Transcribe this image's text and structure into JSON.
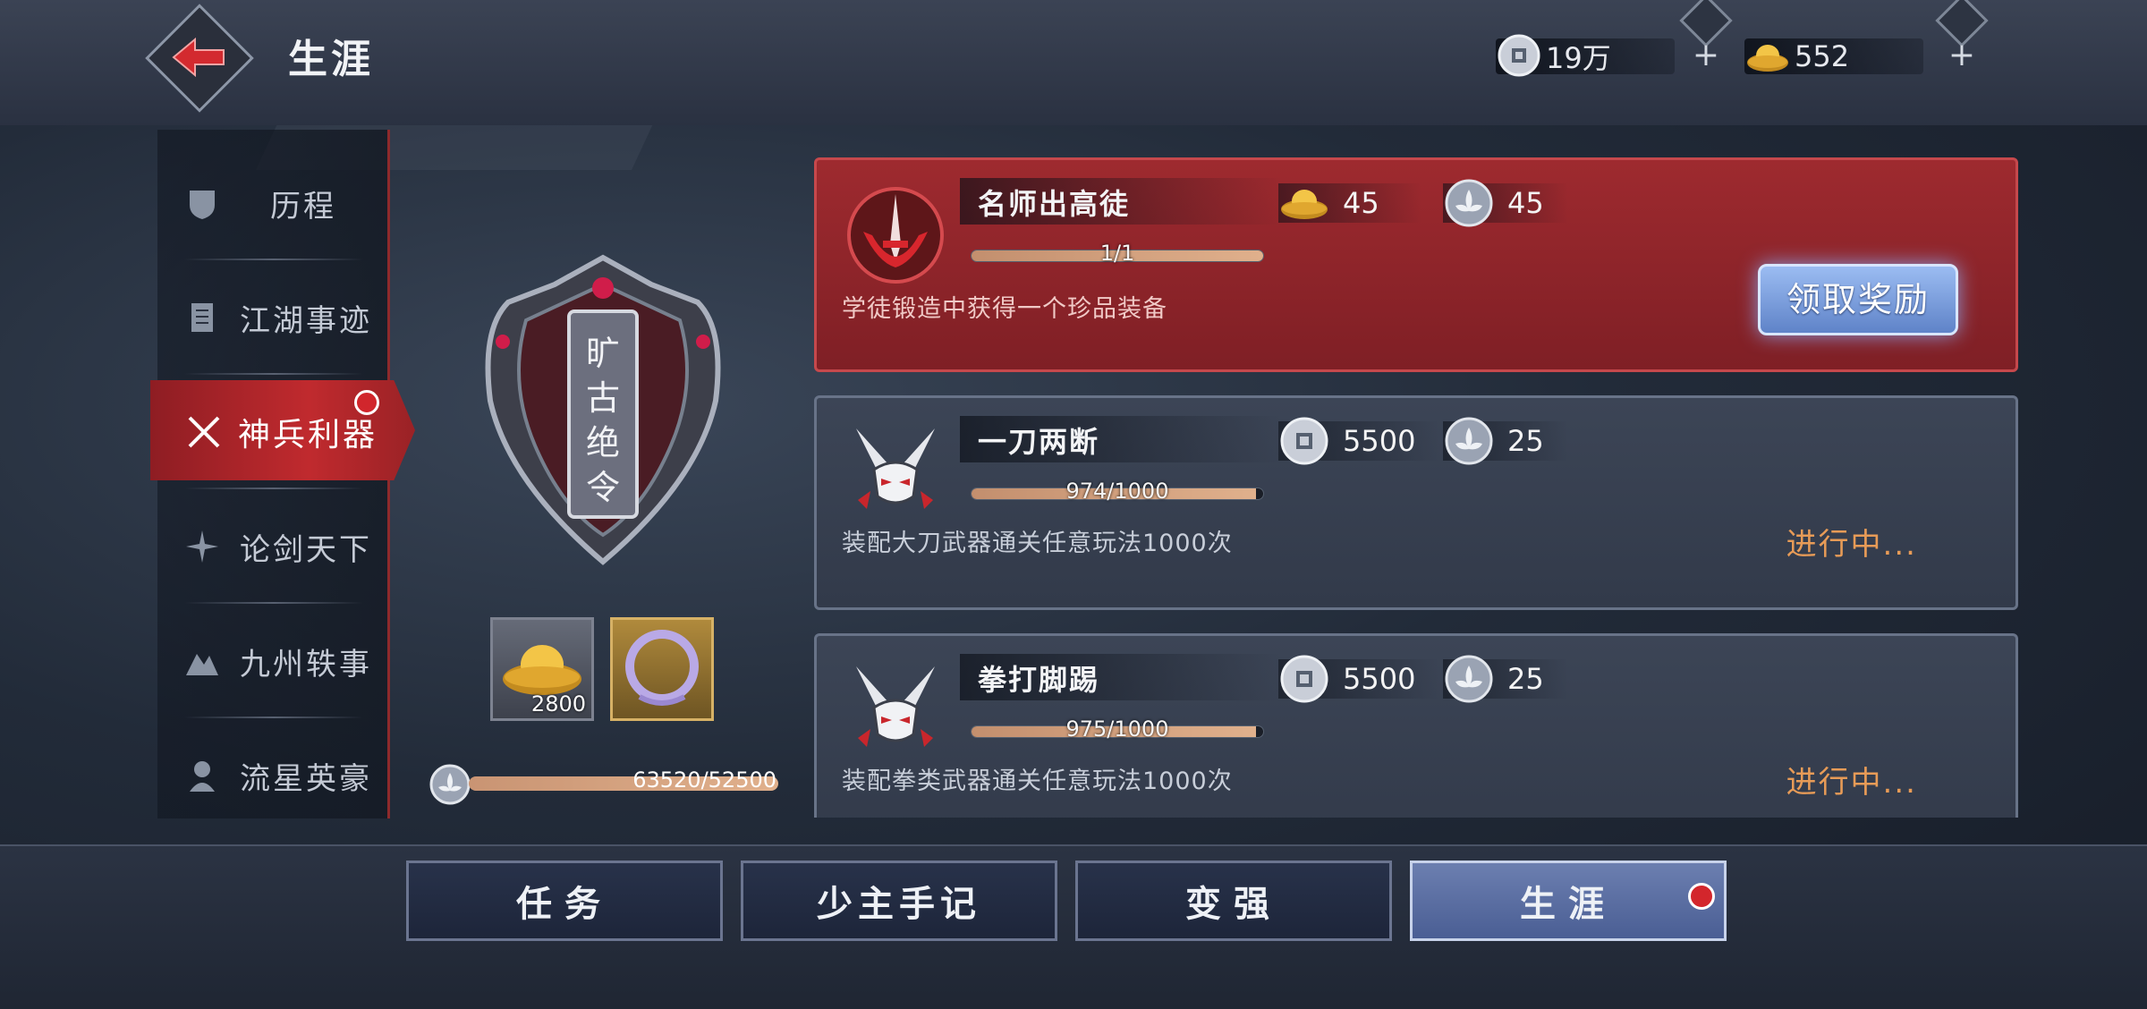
{
  "header": {
    "title": "生涯",
    "silver_amount": "19万",
    "gold_amount": "552"
  },
  "sidebar": {
    "items": [
      {
        "label": "历程",
        "icon": "shield-icon"
      },
      {
        "label": "江湖事迹",
        "icon": "book-icon"
      },
      {
        "label": "神兵利器",
        "icon": "crossed-swords-icon",
        "active": true
      },
      {
        "label": "论剑天下",
        "icon": "sparkle-icon"
      },
      {
        "label": "九州轶事",
        "icon": "mountain-icon"
      },
      {
        "label": "流星英豪",
        "icon": "warrior-icon"
      }
    ]
  },
  "emblem": {
    "plaque_text": "旷古绝令",
    "slot_gold_count": "2800",
    "career_progress_text": "63520/52500",
    "career_progress": 1.0
  },
  "tasks": [
    {
      "name": "名师出高徒",
      "progress_text": "1/1",
      "progress": 1.0,
      "description": "学徒锻造中获得一个珍品装备",
      "reward1": {
        "icon": "gold-ingot-icon",
        "value": "45"
      },
      "reward2": {
        "icon": "lotus-coin-icon",
        "value": "45"
      },
      "action_label": "领取奖励",
      "state": "complete"
    },
    {
      "name": "一刀两断",
      "progress_text": "974/1000",
      "progress": 0.974,
      "description": "装配大刀武器通关任意玩法1000次",
      "reward1": {
        "icon": "silver-coin-icon",
        "value": "5500"
      },
      "reward2": {
        "icon": "lotus-coin-icon",
        "value": "25"
      },
      "status_label": "进行中...",
      "state": "in-progress"
    },
    {
      "name": "拳打脚踢",
      "progress_text": "975/1000",
      "progress": 0.975,
      "description": "装配拳类武器通关任意玩法1000次",
      "reward1": {
        "icon": "silver-coin-icon",
        "value": "5500"
      },
      "reward2": {
        "icon": "lotus-coin-icon",
        "value": "25"
      },
      "status_label": "进行中...",
      "state": "in-progress"
    }
  ],
  "bottom_tabs": [
    {
      "label": "任务"
    },
    {
      "label": "少主手记"
    },
    {
      "label": "变强"
    },
    {
      "label": "生涯",
      "active": true
    }
  ],
  "colors": {
    "accent_red": "#c02a2e",
    "progress_fill": "#e0b08c",
    "status_orange": "#e79b57",
    "claim_blue": "#7fa2e0"
  }
}
